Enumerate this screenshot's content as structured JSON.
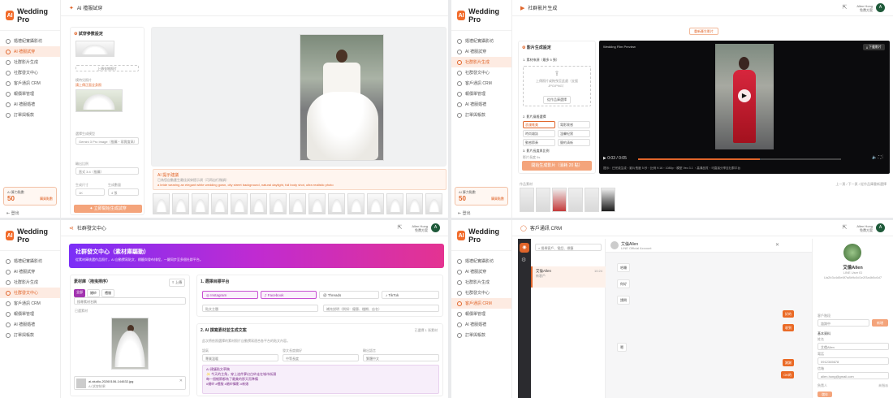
{
  "brand": {
    "name": "Wedding Pro",
    "logo": "AI"
  },
  "user": {
    "name": "Allen Hong",
    "role": "免費方案",
    "initial": "A"
  },
  "nav_items": [
    "婚禮紀實攝影坊",
    "AI 禮服試穿",
    "社群影片生成",
    "社群發文中心",
    "客戶通訊 CRM",
    "報價單管理",
    "AI 禮服婚禮",
    "訂單與帳款"
  ],
  "credit": {
    "label": "AI 算力點數",
    "value": "50",
    "buy": "購買點數"
  },
  "logout": "登出",
  "q1": {
    "title": "AI 禮服試穿",
    "settings_title": "試穿參數設定",
    "upload_label": "上傳衣物照片",
    "model_label": "模特兒照片",
    "model_hint": "請上傳正面全身照",
    "engine_label": "選擇生成模型",
    "engine_value": "Gemini 3 Pro Image（推薦・寫實度高）",
    "ratio_label": "輸出比例",
    "ratio_value": "直式 3:4（推薦）",
    "size_label": "生成尺寸",
    "size_value": "1K",
    "count_label": "生成數量",
    "count_value": "4 張",
    "generate_button": "✦ 立即開始生成試穿",
    "notice_title": "AI 提示建議",
    "notice_text": "已為您自動產生最佳試穿提示詞（可再自行微調）",
    "prompt_text": "a bride wearing an elegant white wedding gown, city street background, natural daylight, full body shot, ultra realistic photo"
  },
  "q2": {
    "title": "社群影片生成",
    "top_button": "重新產生影片",
    "settings_title": "影片生成設定",
    "step1": "1. 素材來源（最多 5 張）",
    "upload_hint": "上傳照片或拖曳至此處（支援 JPG/PNG）",
    "upload_button": "從作品庫選擇",
    "step2": "2. 影片風格選擇",
    "styles": [
      "浪漫唯美",
      "電影質感",
      "時尚雜誌",
      "溫馨紀實",
      "動感節奏",
      "簡約清新"
    ],
    "step3": "3. 影片長度與比例",
    "duration_label": "影片長度",
    "duration_value": "5s",
    "generate_button": "開始生成影片（消耗 20 點）",
    "video_title": "Wedding Film Preview",
    "download_button": "下載影片",
    "time_current": "0:03",
    "time_total": "0:05",
    "caption": "提示：已完成生成・影片長度 5 秒・比例 9:16・1080p・模型 Veo 3.1 ・高清品質・可直接分享至社群平台",
    "material_label": "作品素材",
    "material_link": "上一頁 / 下一頁 / 從作品庫重新選擇",
    "credit_value": "50"
  },
  "q3": {
    "title": "社群發文中心",
    "banner_title": "社群發文中心（素材庫驅動）",
    "banner_sub": "從素材庫挑選作品照片，AI 自動撰寫貼文、標籤與發布排程，一鍵同步至多個社群平台。",
    "library_title": "素材庫（拖曳排序）",
    "upload_button": "上傳",
    "tabs": [
      "全部",
      "婚紗",
      "禮服"
    ],
    "search_placeholder": "搜尋素材名稱",
    "selected_label": "已選素材",
    "file_name": "ai-studio-20260106-144632.jpg",
    "file_meta": "AI 試穿結果",
    "step1": "1. 選擇目標平台",
    "platforms": [
      "Instagram",
      "Facebook",
      "Threads",
      "TikTok"
    ],
    "hashtag_placeholder": "貼文主題",
    "hashtag_placeholder2": "補充說明（例如：優惠、檔期、店名）",
    "step2": "2. AI 撰寫素材並生成文案",
    "copy_link": "已選擇 1 張素材",
    "draft_hint": "此次將依照選擇的素材照片自動撰寫適合各平台的貼文內容。",
    "field_labels": [
      "語氣",
      "發文長度偏好",
      "輸出語言"
    ],
    "field_values": [
      "專業溫暖",
      "中等長度",
      "繁體中文"
    ],
    "ai_lines": [
      "AI 建議貼文草稿",
      "✨ 今天的主角，穿上這件夢幻白紗走在城市街頭",
      "每一個細節都為了最美的那天而準備",
      "#婚紗 #禮服 #婚紗攝影 #新娘"
    ]
  },
  "q4": {
    "title": "客戶通訊 CRM",
    "search_placeholder": "搜尋客戶、電話、標籤",
    "client_name": "艾倫Allen",
    "client_tag": "新客戶",
    "client_time": "10:24",
    "chat_name": "艾倫Allen",
    "chat_sub": "LINE Official Account",
    "messages_in": [
      "哈囉",
      "你好",
      "請問",
      "嗯"
    ],
    "messages_out": [
      "好的",
      "收到",
      "謝謝",
      "OK的"
    ],
    "profile_name": "艾倫Allen",
    "profile_id": "LINE User ID",
    "profile_uid": "Ua2b3c4d5e6f7a8b9c0d1e2f3a4b5c6d7",
    "stage_label": "客戶階段",
    "stage_value": "諮詢中",
    "add_tag": "新增",
    "info_title": "基本資料",
    "name_label": "姓名",
    "name_value": "艾倫Allen",
    "phone_label": "電話",
    "phone_value": "0912345678",
    "email_label": "信箱",
    "email_value": "allen.hong@gmail.com",
    "save_button": "儲存",
    "assign_label": "負責人",
    "assign_value": "未指派"
  }
}
